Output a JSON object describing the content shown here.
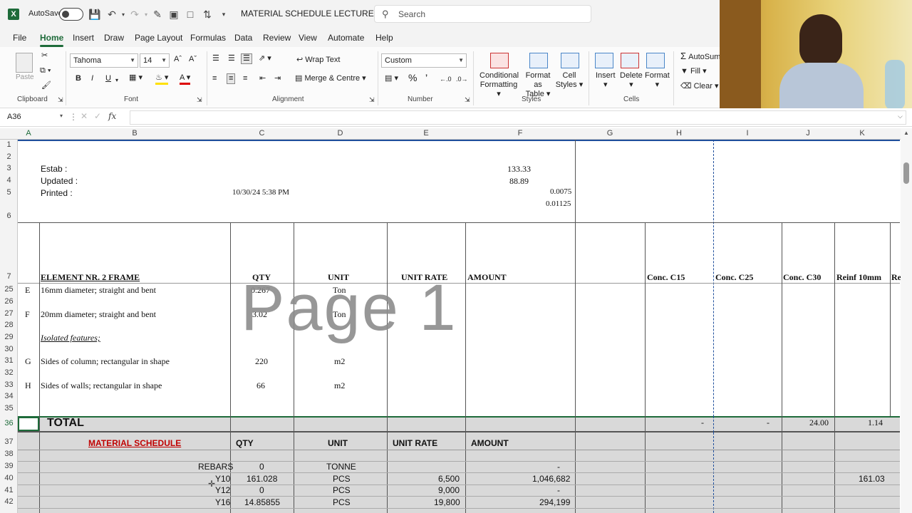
{
  "titlebar": {
    "autosave_label": "AutoSave",
    "doc_title": "MATERIAL SCHEDULE LECTURE...",
    "search_placeholder": "Search"
  },
  "menu": [
    "File",
    "Home",
    "Insert",
    "Draw",
    "Page Layout",
    "Formulas",
    "Data",
    "Review",
    "View",
    "Automate",
    "Help"
  ],
  "ribbon": {
    "clipboard": {
      "paste": "Paste",
      "label": "Clipboard"
    },
    "font": {
      "name": "Tahoma",
      "size": "14",
      "label": "Font",
      "bold": "B",
      "italic": "I",
      "underline": "U"
    },
    "alignment": {
      "wrap": "Wrap Text",
      "merge": "Merge & Centre",
      "label": "Alignment"
    },
    "number": {
      "format": "Custom",
      "label": "Number"
    },
    "styles": {
      "conditional": "Conditional",
      "formatting": "Formatting",
      "format_as": "Format as",
      "table": "Table",
      "cell": "Cell",
      "cell_styles": "Styles",
      "label": "Styles"
    },
    "cells": {
      "insert": "Insert",
      "delete": "Delete",
      "format": "Format",
      "label": "Cells"
    },
    "editing": {
      "autosum": "AutoSum",
      "fill": "Fill",
      "clear": "Clear"
    }
  },
  "formula_bar": {
    "name_box": "A36",
    "fx": "fx"
  },
  "columns": [
    "A",
    "B",
    "C",
    "D",
    "E",
    "F",
    "G",
    "H",
    "I",
    "J",
    "K"
  ],
  "rows": [
    "1",
    "2",
    "3",
    "4",
    "5",
    "6",
    "7",
    "25",
    "26",
    "27",
    "28",
    "29",
    "30",
    "31",
    "32",
    "33",
    "34",
    "35",
    "36",
    "37",
    "38",
    "39",
    "40",
    "41",
    "42"
  ],
  "sheet": {
    "estab": "Estab :",
    "estab_val": "133.33",
    "updated": "Updated :",
    "updated_val": "88.89",
    "printed": "Printed :",
    "printed_date": "10/30/24 5:38 PM",
    "printed_val": "0.0075",
    "row6_val": "0.01125",
    "header": {
      "element": "ELEMENT NR. 2 FRAME",
      "qty": "QTY",
      "unit": "UNIT",
      "rate": "UNIT RATE",
      "amount": "AMOUNT",
      "c15": "Conc. C15",
      "c25": "Conc. C25",
      "c30": "Conc. C30",
      "reinf": "Reinf 10mm",
      "re": "Re"
    },
    "items": [
      {
        "code": "E",
        "desc": "16mm diameter; straight and bent",
        "qty": "0.267",
        "unit": "Ton"
      },
      {
        "code": "F",
        "desc": "20mm diameter; straight and bent",
        "qty": "3.02",
        "unit": "Ton"
      },
      {
        "code": "",
        "desc": "Isolated features;",
        "qty": "",
        "unit": ""
      },
      {
        "code": "G",
        "desc": "Sides of  column; rectangular in shape",
        "qty": "220",
        "unit": "m2"
      },
      {
        "code": "H",
        "desc": "Sides of walls; rectangular in shape",
        "qty": "66",
        "unit": "m2"
      }
    ],
    "total": {
      "label": "TOTAL",
      "h": "-",
      "i": "-",
      "j": "24.00",
      "k": "1.14"
    },
    "ms_header": {
      "title": "MATERIAL SCHEDULE",
      "qty": "QTY",
      "unit": "UNIT",
      "rate": "UNIT RATE",
      "amount": "AMOUNT"
    },
    "ms_rows": [
      {
        "name": "REBARS",
        "qty": "0",
        "unit": "TONNE",
        "rate": "",
        "amount": "-",
        "k": ""
      },
      {
        "name": "Y10",
        "qty": "161.028",
        "unit": "PCS",
        "rate": "6,500",
        "amount": "1,046,682",
        "k": "161.03"
      },
      {
        "name": "Y12",
        "qty": "0",
        "unit": "PCS",
        "rate": "9,000",
        "amount": "-",
        "k": ""
      },
      {
        "name": "Y16",
        "qty": "14.85855",
        "unit": "PCS",
        "rate": "19,800",
        "amount": "294,199",
        "k": ""
      }
    ]
  },
  "watermark": "Page 1",
  "colors": {
    "excel_green": "#1e6b3a",
    "ms_title": "#c00000",
    "total_bg": "#d9d9d9"
  }
}
